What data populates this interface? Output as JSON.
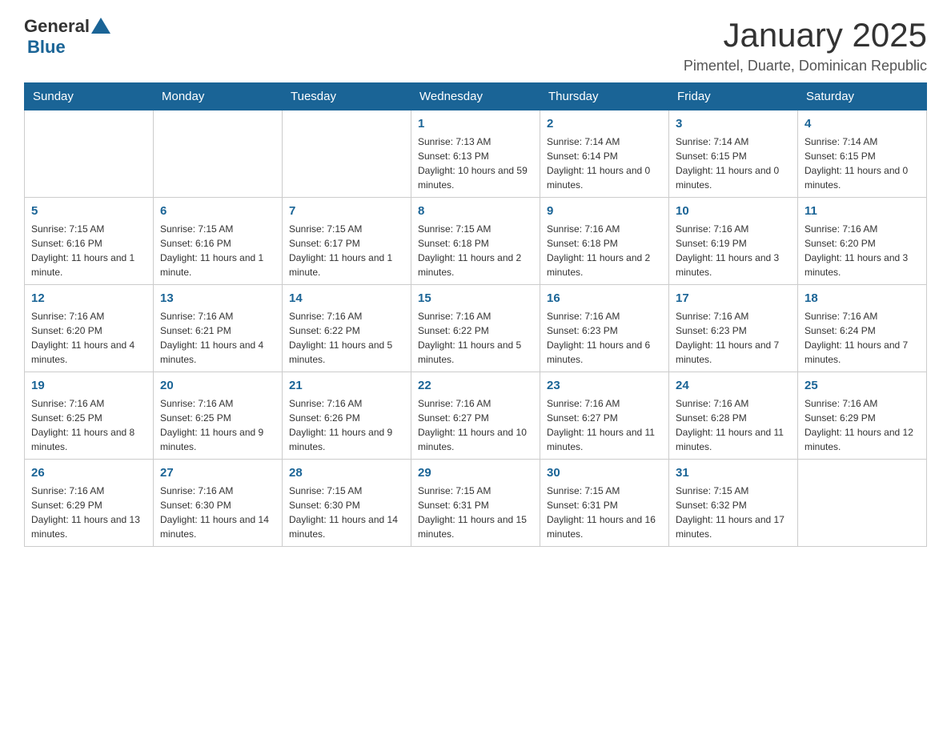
{
  "header": {
    "logo": {
      "general": "General",
      "blue": "Blue",
      "triangle_color": "#1a6496"
    },
    "title": "January 2025",
    "location": "Pimentel, Duarte, Dominican Republic"
  },
  "calendar": {
    "days_of_week": [
      "Sunday",
      "Monday",
      "Tuesday",
      "Wednesday",
      "Thursday",
      "Friday",
      "Saturday"
    ],
    "weeks": [
      [
        {
          "day": "",
          "info": ""
        },
        {
          "day": "",
          "info": ""
        },
        {
          "day": "",
          "info": ""
        },
        {
          "day": "1",
          "info": "Sunrise: 7:13 AM\nSunset: 6:13 PM\nDaylight: 10 hours and 59 minutes."
        },
        {
          "day": "2",
          "info": "Sunrise: 7:14 AM\nSunset: 6:14 PM\nDaylight: 11 hours and 0 minutes."
        },
        {
          "day": "3",
          "info": "Sunrise: 7:14 AM\nSunset: 6:15 PM\nDaylight: 11 hours and 0 minutes."
        },
        {
          "day": "4",
          "info": "Sunrise: 7:14 AM\nSunset: 6:15 PM\nDaylight: 11 hours and 0 minutes."
        }
      ],
      [
        {
          "day": "5",
          "info": "Sunrise: 7:15 AM\nSunset: 6:16 PM\nDaylight: 11 hours and 1 minute."
        },
        {
          "day": "6",
          "info": "Sunrise: 7:15 AM\nSunset: 6:16 PM\nDaylight: 11 hours and 1 minute."
        },
        {
          "day": "7",
          "info": "Sunrise: 7:15 AM\nSunset: 6:17 PM\nDaylight: 11 hours and 1 minute."
        },
        {
          "day": "8",
          "info": "Sunrise: 7:15 AM\nSunset: 6:18 PM\nDaylight: 11 hours and 2 minutes."
        },
        {
          "day": "9",
          "info": "Sunrise: 7:16 AM\nSunset: 6:18 PM\nDaylight: 11 hours and 2 minutes."
        },
        {
          "day": "10",
          "info": "Sunrise: 7:16 AM\nSunset: 6:19 PM\nDaylight: 11 hours and 3 minutes."
        },
        {
          "day": "11",
          "info": "Sunrise: 7:16 AM\nSunset: 6:20 PM\nDaylight: 11 hours and 3 minutes."
        }
      ],
      [
        {
          "day": "12",
          "info": "Sunrise: 7:16 AM\nSunset: 6:20 PM\nDaylight: 11 hours and 4 minutes."
        },
        {
          "day": "13",
          "info": "Sunrise: 7:16 AM\nSunset: 6:21 PM\nDaylight: 11 hours and 4 minutes."
        },
        {
          "day": "14",
          "info": "Sunrise: 7:16 AM\nSunset: 6:22 PM\nDaylight: 11 hours and 5 minutes."
        },
        {
          "day": "15",
          "info": "Sunrise: 7:16 AM\nSunset: 6:22 PM\nDaylight: 11 hours and 5 minutes."
        },
        {
          "day": "16",
          "info": "Sunrise: 7:16 AM\nSunset: 6:23 PM\nDaylight: 11 hours and 6 minutes."
        },
        {
          "day": "17",
          "info": "Sunrise: 7:16 AM\nSunset: 6:23 PM\nDaylight: 11 hours and 7 minutes."
        },
        {
          "day": "18",
          "info": "Sunrise: 7:16 AM\nSunset: 6:24 PM\nDaylight: 11 hours and 7 minutes."
        }
      ],
      [
        {
          "day": "19",
          "info": "Sunrise: 7:16 AM\nSunset: 6:25 PM\nDaylight: 11 hours and 8 minutes."
        },
        {
          "day": "20",
          "info": "Sunrise: 7:16 AM\nSunset: 6:25 PM\nDaylight: 11 hours and 9 minutes."
        },
        {
          "day": "21",
          "info": "Sunrise: 7:16 AM\nSunset: 6:26 PM\nDaylight: 11 hours and 9 minutes."
        },
        {
          "day": "22",
          "info": "Sunrise: 7:16 AM\nSunset: 6:27 PM\nDaylight: 11 hours and 10 minutes."
        },
        {
          "day": "23",
          "info": "Sunrise: 7:16 AM\nSunset: 6:27 PM\nDaylight: 11 hours and 11 minutes."
        },
        {
          "day": "24",
          "info": "Sunrise: 7:16 AM\nSunset: 6:28 PM\nDaylight: 11 hours and 11 minutes."
        },
        {
          "day": "25",
          "info": "Sunrise: 7:16 AM\nSunset: 6:29 PM\nDaylight: 11 hours and 12 minutes."
        }
      ],
      [
        {
          "day": "26",
          "info": "Sunrise: 7:16 AM\nSunset: 6:29 PM\nDaylight: 11 hours and 13 minutes."
        },
        {
          "day": "27",
          "info": "Sunrise: 7:16 AM\nSunset: 6:30 PM\nDaylight: 11 hours and 14 minutes."
        },
        {
          "day": "28",
          "info": "Sunrise: 7:15 AM\nSunset: 6:30 PM\nDaylight: 11 hours and 14 minutes."
        },
        {
          "day": "29",
          "info": "Sunrise: 7:15 AM\nSunset: 6:31 PM\nDaylight: 11 hours and 15 minutes."
        },
        {
          "day": "30",
          "info": "Sunrise: 7:15 AM\nSunset: 6:31 PM\nDaylight: 11 hours and 16 minutes."
        },
        {
          "day": "31",
          "info": "Sunrise: 7:15 AM\nSunset: 6:32 PM\nDaylight: 11 hours and 17 minutes."
        },
        {
          "day": "",
          "info": ""
        }
      ]
    ]
  }
}
